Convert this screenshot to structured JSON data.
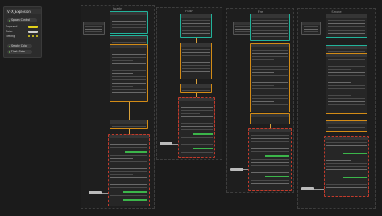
{
  "panel": {
    "title": "VFX_Explosion",
    "rows": [
      {
        "label": "Spawn Control"
      },
      {
        "label": "Exposed"
      },
      {
        "label": "Color"
      },
      {
        "label": "Timing"
      }
    ],
    "pills": [
      {
        "label": "Smoke Color"
      },
      {
        "label": "Flash Color"
      }
    ],
    "accent_yellow": "#e3d21a",
    "accent_teal": "#22b39b",
    "accent_orange": "#d28b16",
    "accent_red": "#c23a2b"
  },
  "frames": [
    {
      "title": "Sparks"
    },
    {
      "title": "Flash"
    },
    {
      "title": "Fire"
    },
    {
      "title": "Smoke"
    }
  ]
}
